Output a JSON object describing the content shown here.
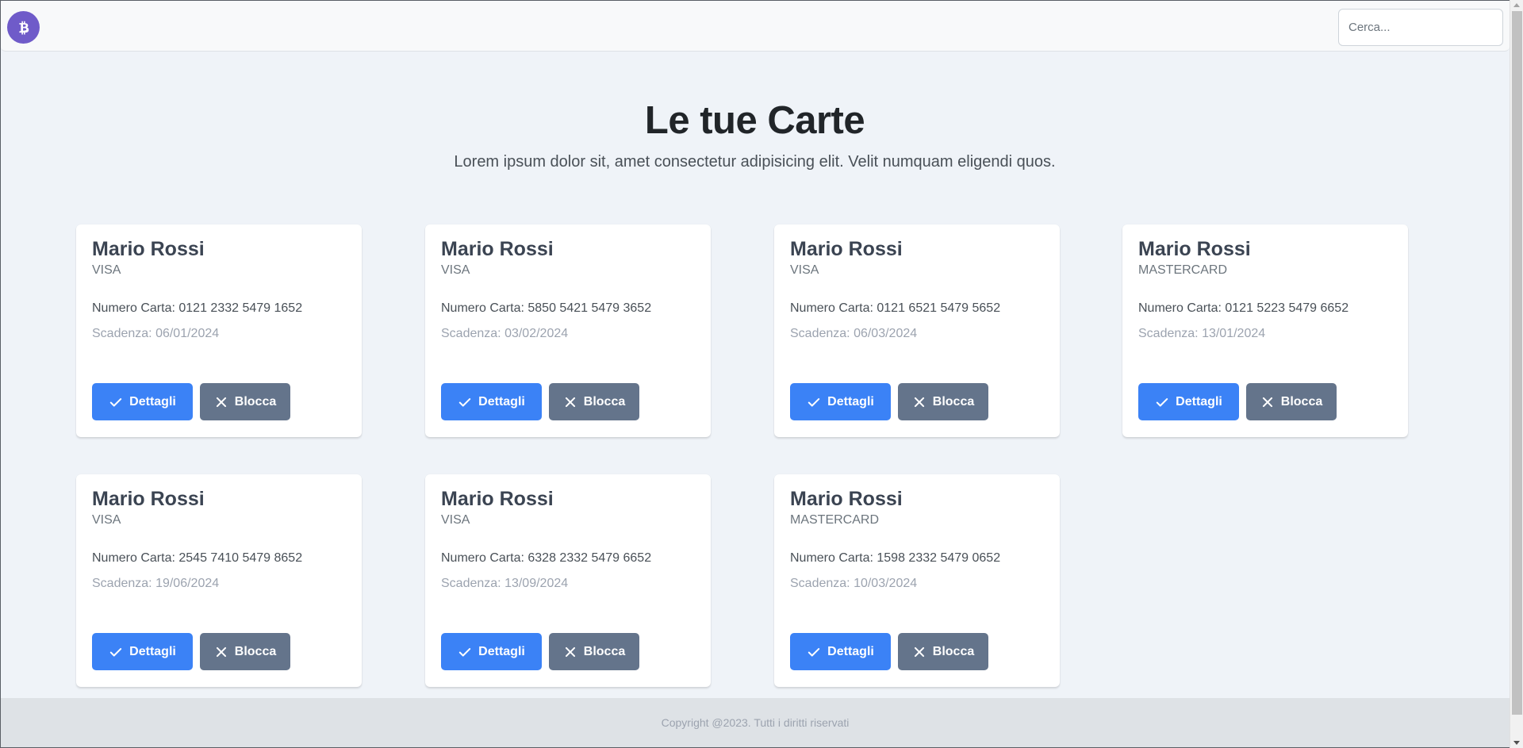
{
  "header": {
    "logo_icon": "bitcoin-icon",
    "search_placeholder": "Cerca..."
  },
  "hero": {
    "title": "Le tue Carte",
    "subtitle": "Lorem ipsum dolor sit, amet consectetur adipisicing elit. Velit numquam eligendi quos."
  },
  "labels": {
    "number_prefix": "Numero Carta: ",
    "expiry_prefix": "Scadenza: ",
    "details_button": "Dettagli",
    "block_button": "Blocca"
  },
  "cards": [
    {
      "name": "Mario Rossi",
      "type": "VISA",
      "number": "0121 2332 5479 1652",
      "expiry": "06/01/2024"
    },
    {
      "name": "Mario Rossi",
      "type": "VISA",
      "number": "5850 5421 5479 3652",
      "expiry": "03/02/2024"
    },
    {
      "name": "Mario Rossi",
      "type": "VISA",
      "number": "0121 6521 5479 5652",
      "expiry": "06/03/2024"
    },
    {
      "name": "Mario Rossi",
      "type": "MASTERCARD",
      "number": "0121 5223 5479 6652",
      "expiry": "13/01/2024"
    },
    {
      "name": "Mario Rossi",
      "type": "VISA",
      "number": "2545 7410 5479 8652",
      "expiry": "19/06/2024"
    },
    {
      "name": "Mario Rossi",
      "type": "VISA",
      "number": "6328 2332 5479 6652",
      "expiry": "13/09/2024"
    },
    {
      "name": "Mario Rossi",
      "type": "MASTERCARD",
      "number": "1598 2332 5479 0652",
      "expiry": "10/03/2024"
    }
  ],
  "footer": {
    "copyright": "Copyright @2023. Tutti i diritti riservati"
  },
  "colors": {
    "primary": "#3b82f6",
    "secondary": "#64748b",
    "logo": "#6f5bc9",
    "background": "#eff3f8"
  }
}
